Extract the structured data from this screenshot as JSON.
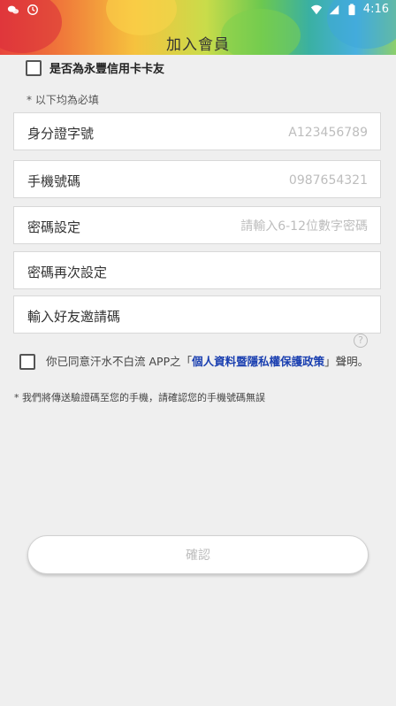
{
  "status_bar": {
    "time": "4:16",
    "icons": [
      "wechat-icon",
      "clock-icon",
      "wifi-icon",
      "signal-icon",
      "battery-icon"
    ]
  },
  "header": {
    "title": "加入會員"
  },
  "credit_card_member": {
    "label": "是否為永豐信用卡卡友",
    "checked": false
  },
  "required_note": "* 以下均為必填",
  "fields": [
    {
      "label": "身分證字號",
      "placeholder": "A123456789",
      "value": ""
    },
    {
      "label": "手機號碼",
      "placeholder": "0987654321",
      "value": ""
    },
    {
      "label": "密碼設定",
      "placeholder": "請輸入6-12位數字密碼",
      "value": ""
    },
    {
      "label": "密碼再次設定",
      "placeholder": "",
      "value": ""
    },
    {
      "label": "輸入好友邀請碼",
      "placeholder": "",
      "value": ""
    }
  ],
  "agreement": {
    "prefix": "你已同意汗水不白流 APP之「",
    "policy_link": "個人資料暨隱私權保護政策",
    "suffix": "」聲明。",
    "checked": false
  },
  "help_icon": "?",
  "sms_note": "* 我們將傳送驗證碼至您的手機，請確認您的手機號碼無誤",
  "confirm_button": {
    "label": "確認"
  },
  "colors": {
    "accent_link": "#1a3fb0",
    "background": "#efefef",
    "placeholder": "#bdbdbd"
  }
}
